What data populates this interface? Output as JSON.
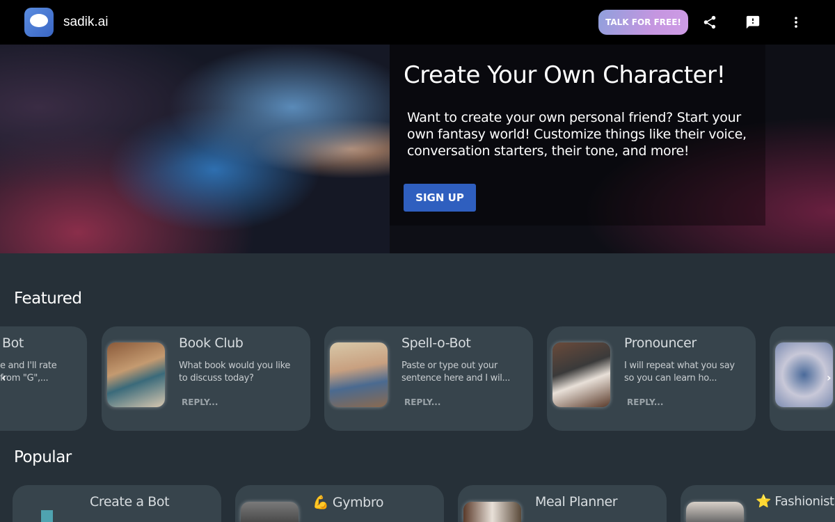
{
  "header": {
    "brand": "sadik.ai",
    "talk_label": "TALK FOR FREE!",
    "icons": [
      "share-icon",
      "feedback-icon",
      "more-vert-icon"
    ]
  },
  "hero": {
    "title": "Create Your Own Character!",
    "text": "Want to create your own personal friend? Start your own fantasy world! Customize things like their voice, conversation starters, their tone, and more!",
    "signup_label": "SIGN UP"
  },
  "featured": {
    "title": "Featured",
    "cards": [
      {
        "title": "Bot",
        "desc": "e and I'll rate from \"G\",...",
        "reply": ""
      },
      {
        "title": "Book Club",
        "desc": "What book would you like to discuss today?",
        "reply": "REPLY..."
      },
      {
        "title": "Spell-o-Bot",
        "desc": "Paste or type out your sentence here and I wil...",
        "reply": "REPLY..."
      },
      {
        "title": "Pronouncer",
        "desc": "I will repeat what you say so you can learn ho...",
        "reply": "REPLY..."
      },
      {
        "title": "",
        "desc": "",
        "reply": ""
      }
    ]
  },
  "popular": {
    "title": "Popular",
    "cards": [
      {
        "title": "Create a Bot"
      },
      {
        "title": "💪 Gymbro"
      },
      {
        "title": "Meal Planner"
      },
      {
        "title": "⭐ Fashionista"
      }
    ]
  }
}
